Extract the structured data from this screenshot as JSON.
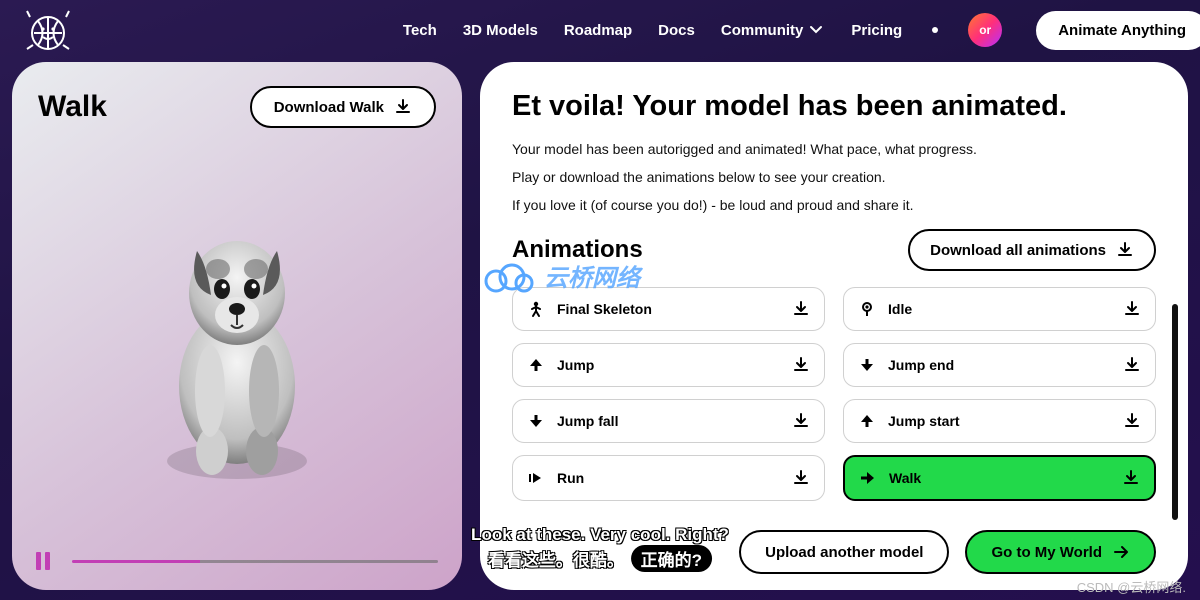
{
  "nav": {
    "items": [
      "Tech",
      "3D Models",
      "Roadmap",
      "Docs",
      "Community",
      "Pricing"
    ],
    "or_badge": "or",
    "cta": "Animate Anything"
  },
  "left": {
    "title": "Walk",
    "download_label": "Download Walk"
  },
  "right": {
    "headline": "Et voila! Your model has been animated.",
    "desc1": "Your model has been autorigged and animated! What pace, what progress.",
    "desc2": "Play or download the animations below to see your creation.",
    "desc3": "If you love it (of course you do!) - be loud and proud and share it.",
    "animations_title": "Animations",
    "download_all": "Download all animations",
    "upload_label": "Upload another model",
    "goto_label": "Go to My World"
  },
  "animations": [
    {
      "label": "Final Skeleton",
      "icon": "person",
      "selected": false
    },
    {
      "label": "Idle",
      "icon": "pin",
      "selected": false
    },
    {
      "label": "Jump",
      "icon": "arrow-up",
      "selected": false
    },
    {
      "label": "Jump end",
      "icon": "arrow-down",
      "selected": false
    },
    {
      "label": "Jump fall",
      "icon": "arrow-down",
      "selected": false
    },
    {
      "label": "Jump start",
      "icon": "arrow-up",
      "selected": false
    },
    {
      "label": "Run",
      "icon": "fast-right",
      "selected": false
    },
    {
      "label": "Walk",
      "icon": "arrow-right",
      "selected": true
    }
  ],
  "subtitles": {
    "line1": "Look at these. Very cool. Right?",
    "line2_a": "看看这些。很酷。",
    "line2_pill": "正确的?"
  },
  "watermarks": {
    "logo_text": "云桥网络",
    "csdn": "CSDN @云桥网络."
  }
}
